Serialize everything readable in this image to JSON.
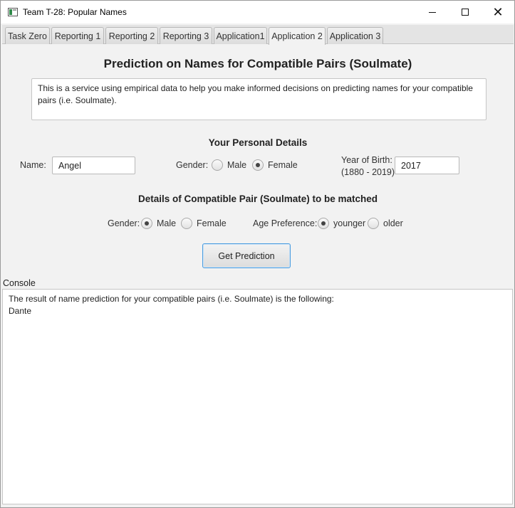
{
  "window": {
    "title": "Team T-28: Popular Names",
    "minimize_icon": "minimize-icon",
    "maximize_icon": "maximize-icon",
    "close_icon": "close-icon"
  },
  "tabs": [
    {
      "label": "Task Zero",
      "active": false
    },
    {
      "label": "Reporting 1",
      "active": false
    },
    {
      "label": "Reporting 2",
      "active": false
    },
    {
      "label": "Reporting 3",
      "active": false
    },
    {
      "label": "Application1",
      "active": false
    },
    {
      "label": "Application 2",
      "active": true
    },
    {
      "label": "Application 3",
      "active": false
    }
  ],
  "page": {
    "heading": "Prediction on Names for Compatible Pairs (Soulmate)",
    "description": "This is a service using empirical data to help you make informed decisions on predicting names for your compatible pairs (i.e. Soulmate)."
  },
  "personal": {
    "heading": "Your Personal Details",
    "name_label": "Name:",
    "name_value": "Angel",
    "gender_label": "Gender:",
    "gender_options": [
      "Male",
      "Female"
    ],
    "gender_selected": "Female",
    "yob_label_line1": "Year of Birth:",
    "yob_label_line2": "(1880 - 2019)",
    "yob_value": "2017"
  },
  "match": {
    "heading": "Details of Compatible Pair (Soulmate) to be matched",
    "gender_label": "Gender:",
    "gender_options": [
      "Male",
      "Female"
    ],
    "gender_selected": "Male",
    "age_label": "Age Preference:",
    "age_options": [
      "younger",
      "older"
    ],
    "age_selected": "younger"
  },
  "action": {
    "button_label": "Get Prediction"
  },
  "console": {
    "label": "Console",
    "line1": "The result of name prediction for your compatible pairs (i.e. Soulmate) is the following:",
    "line2": "Dante"
  }
}
